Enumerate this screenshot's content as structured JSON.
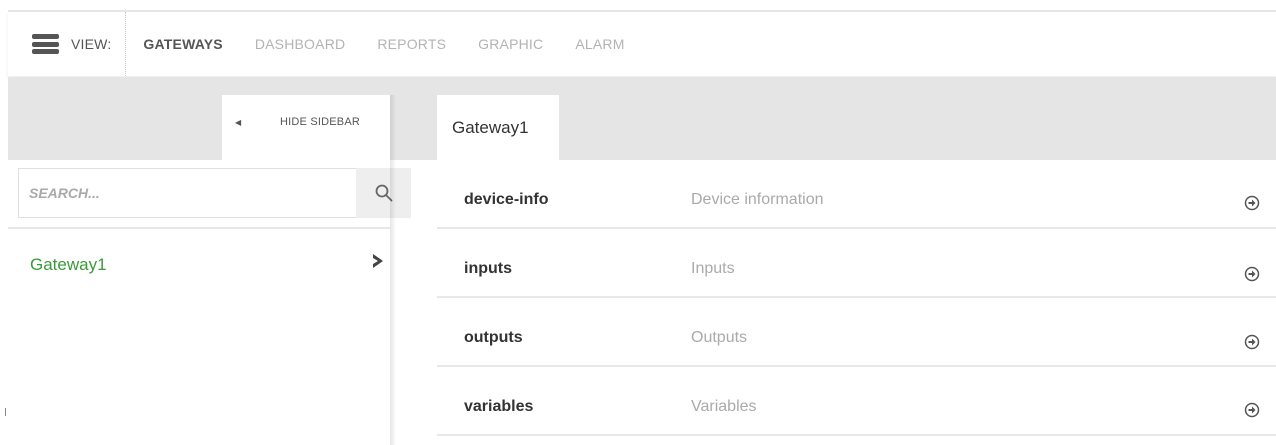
{
  "topbar": {
    "view_label": "VIEW:",
    "nav": [
      {
        "label": "GATEWAYS",
        "active": true
      },
      {
        "label": "DASHBOARD",
        "active": false
      },
      {
        "label": "REPORTS",
        "active": false
      },
      {
        "label": "GRAPHIC",
        "active": false
      },
      {
        "label": "ALARM",
        "active": false
      }
    ]
  },
  "sidebar": {
    "hide_label": "HIDE SIDEBAR",
    "search_placeholder": "SEARCH...",
    "items": [
      {
        "label": "Gateway1"
      }
    ]
  },
  "content": {
    "tab_label": "Gateway1",
    "rows": [
      {
        "key": "device-info",
        "description": "Device information"
      },
      {
        "key": "inputs",
        "description": "Inputs"
      },
      {
        "key": "outputs",
        "description": "Outputs"
      },
      {
        "key": "variables",
        "description": "Variables"
      }
    ]
  },
  "colors": {
    "accent_green": "#3a9a3a",
    "band_gray": "#e5e5e5",
    "text_dark": "#333333",
    "text_muted": "#aaaaaa"
  },
  "icons": {
    "menu": "hamburger-icon",
    "search": "search-icon",
    "hide": "triangle-left-icon",
    "item_open": "chevron-right-icon",
    "row_go": "circle-arrow-right-icon"
  }
}
